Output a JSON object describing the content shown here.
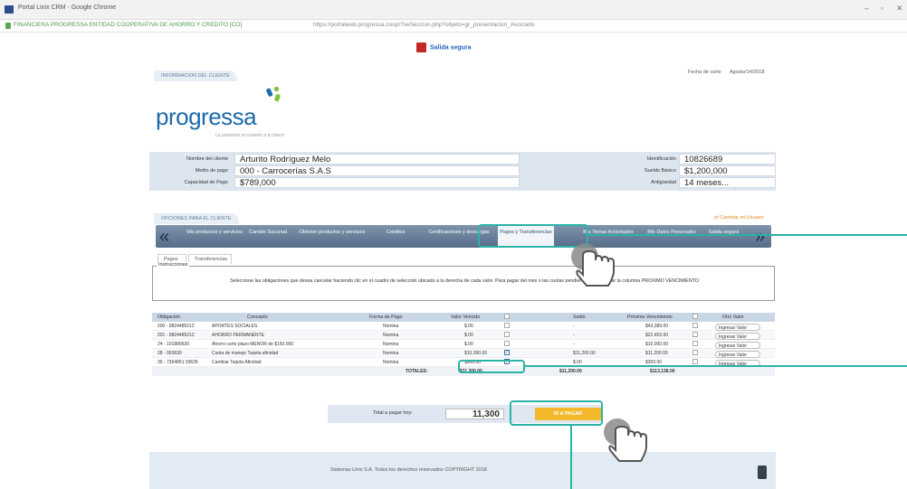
{
  "browser": {
    "title": "Portal Linix CRM - Google Chrome",
    "site": "FINANCIERA PROGRESSA ENTIDAD COOPERATIVA DE AHORRO Y CREDITO [CO]",
    "url_host": "https://portalweb.progressa.coop",
    "url_path": "/?seSeccion.php?objeto=gr_presentacion_Asociado"
  },
  "header": {
    "logout": "Salida segura",
    "section_client": "INFORMACION DEL CLIENTE",
    "fecha_label": "Fecha de corte",
    "fecha_value": "Agosto/14/2018",
    "logo": "progressa",
    "slogan": "Lo ponemos el corazón a tu futuro"
  },
  "client": {
    "rows": [
      {
        "label": "Nombre del cliente",
        "value": "Arturito Rodríguez Melo",
        "label2": "Identificación",
        "value2": "10826689"
      },
      {
        "label": "Medio de pago",
        "value": "000 - Carrocerías S.A.S",
        "label2": "Sueldo Básico",
        "value2": "$1,200,000"
      },
      {
        "label": "Capacidad de Pago",
        "value": "$789,000",
        "label2": "Antigüedad",
        "value2": "14 meses..."
      }
    ]
  },
  "options": {
    "section": "OPCIONES PARA EL CLIENTE",
    "change_client": "Cambiar mi Usuario",
    "nav": [
      "Mis productos y servicios",
      "Cambio Sucursal",
      "Obtener productos y servicios",
      "Créditos",
      "Certificaciones y descargas",
      "Pagos y Transferencias",
      "Mis Temas Actividades",
      "Mis Datos Personales",
      "Salida segura"
    ],
    "subtabs": [
      "Pagos",
      "Transferencias"
    ]
  },
  "instructions": {
    "legend": "Instrucciones",
    "text": "Seleccione las obligaciones que desea cancelar haciendo clic en el cuadro de selección ubicado a la derecha de cada valor. Para pagar del mes o las cuotas pendientes, seleccionar la columna PROXIMO VENCIMIENTO"
  },
  "table": {
    "headers": [
      "Obligación",
      "Concepto",
      "Forma de Pago",
      "Valor Vencido",
      "Saldo",
      "Próximo Vencimiento",
      "Otro Valor"
    ],
    "rows": [
      {
        "obl": "200 - 9824485212",
        "concepto": "APORTES SOCIALES",
        "forma": "Nomina",
        "vencido": "$.00",
        "saldo": "-",
        "proximo": "$43,389.00",
        "otro": "Ingresar Valor",
        "checked": false
      },
      {
        "obl": "201 - 9824485212",
        "concepto": "AHORRO PERMANENTE",
        "forma": "Nomina",
        "vencido": "$.00",
        "saldo": "-",
        "proximo": "$22,453.00",
        "otro": "Ingresar Valor",
        "checked": false
      },
      {
        "obl": "24 - 101889630",
        "concepto": "Ahorro corto plazo MENOR de $150.000",
        "forma": "Nomina",
        "vencido": "$.00",
        "saldo": "-",
        "proximo": "$10,000.00",
        "otro": "Ingresar Valor",
        "checked": false
      },
      {
        "obl": "28 - 003630",
        "concepto": "Cuota de manejo Tarjeta afinidad",
        "forma": "Nomina",
        "vencido": "$10,390.00",
        "saldo": "$11,200.00",
        "proximo": "$11,200.00",
        "otro": "Ingresar Valor",
        "checked": true
      },
      {
        "obl": "30 - 7364851 03635",
        "concepto": "Cambiar Tarjeta Afinidad",
        "forma": "Nomina",
        "vencido": "$900.00",
        "saldo": "$.00",
        "proximo": "$300.00",
        "otro": "Ingresar Valor",
        "checked": true
      }
    ],
    "totals_label": "TOTALES:",
    "totals": [
      "$11,300.00",
      "$11,200.00",
      "$113,138.00"
    ]
  },
  "pay": {
    "label": "Total a pagar hoy:",
    "value": "11,300",
    "button": "IR A PAGAR"
  },
  "footer": {
    "text": "Sistemas Linix S.A. Todos los derechos reservados COPYRIGHT 2018"
  },
  "colors": {
    "accent": "#2ab3a6",
    "brand": "#1e6aa8",
    "pay_button": "#f3b82b"
  }
}
